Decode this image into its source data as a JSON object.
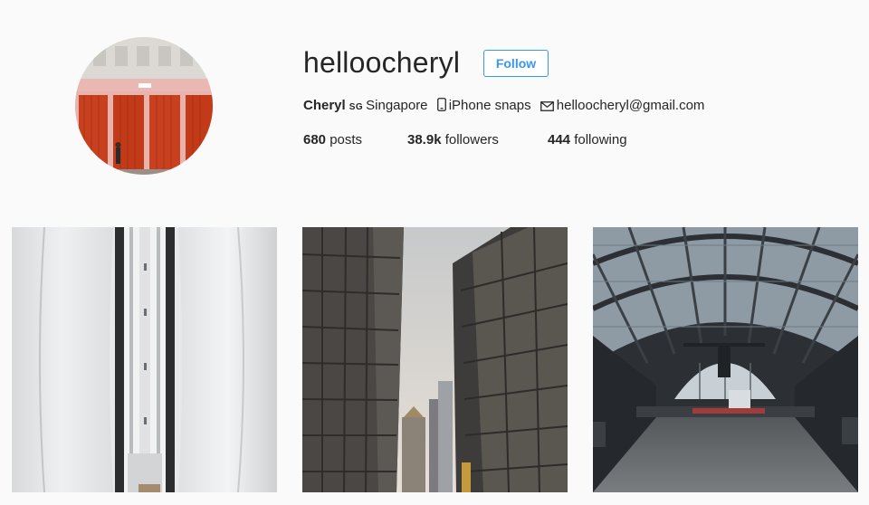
{
  "profile": {
    "username": "helloocheryl",
    "follow_label": "Follow",
    "bio": {
      "name": "Cheryl",
      "country_code": "SG",
      "location": "Singapore",
      "device_icon": "phone-icon",
      "tagline": "iPhone snaps",
      "mail_icon": "mail-icon",
      "email": "helloocheryl@gmail.com"
    },
    "stats": {
      "posts_count": "680",
      "posts_label": "posts",
      "followers_count": "38.9k",
      "followers_label": "followers",
      "following_count": "444",
      "following_label": "following"
    },
    "accent_color": "#3897f0"
  },
  "posts": [
    {
      "subject": "escalator"
    },
    {
      "subject": "city-towers"
    },
    {
      "subject": "train-station"
    }
  ]
}
